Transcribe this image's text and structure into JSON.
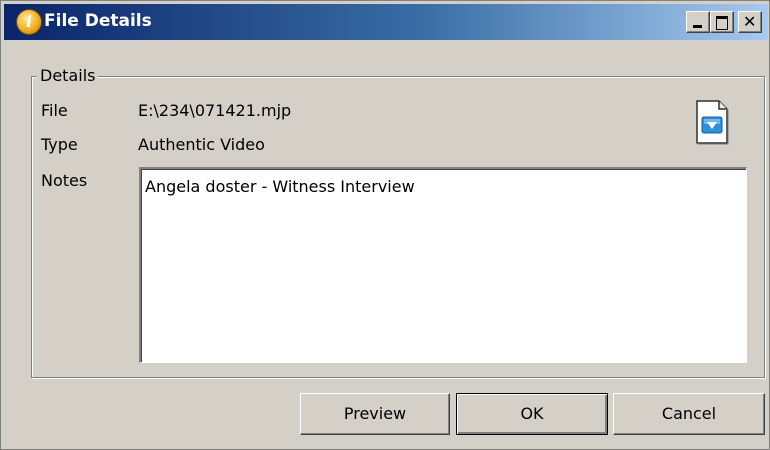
{
  "window": {
    "title": "File Details",
    "title_icon": "info-icon"
  },
  "title_buttons": {
    "minimize": "minimize-icon",
    "maximize": "maximize-icon",
    "close": "close-icon"
  },
  "details": {
    "group_label": "Details",
    "file_label": "File",
    "file_value": "E:\\234\\071421.mjp",
    "type_label": "Type",
    "type_value": "Authentic Video",
    "notes_label": "Notes",
    "notes_value": "Angela doster - Witness Interview",
    "file_type_icon": "video-file-icon"
  },
  "buttons": {
    "preview": "Preview",
    "ok": "OK",
    "cancel": "Cancel"
  },
  "colors": {
    "titlebar_start": "#0a246a",
    "titlebar_end": "#a6caf0",
    "face": "#d4d0c8"
  }
}
